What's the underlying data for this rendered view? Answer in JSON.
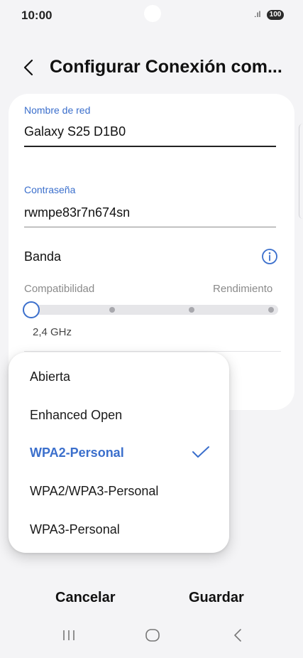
{
  "status_bar": {
    "time": "10:00",
    "battery": "100",
    "signal": ".ıl"
  },
  "header": {
    "title": "Configurar Conexión com..."
  },
  "form": {
    "network_name": {
      "label": "Nombre de red",
      "value": "Galaxy S25 D1B0"
    },
    "password": {
      "label": "Contraseña",
      "value": "rwmpe83r7n674sn"
    },
    "band": {
      "title": "Banda",
      "left_label": "Compatibilidad",
      "right_label": "Rendimiento",
      "selected_value": "2,4 GHz",
      "slider_position": 0,
      "slider_steps": 5
    }
  },
  "security_menu": {
    "options": [
      "Abierta",
      "Enhanced Open",
      "WPA2-Personal",
      "WPA2/WPA3-Personal",
      "WPA3-Personal"
    ],
    "selected": "WPA2-Personal"
  },
  "actions": {
    "cancel": "Cancelar",
    "save": "Guardar"
  },
  "colors": {
    "accent": "#3b6fcc",
    "background": "#f4f4f6",
    "card": "#ffffff"
  },
  "icons": [
    "back-arrow-icon",
    "info-icon",
    "check-icon",
    "recents-icon",
    "home-icon",
    "back-nav-icon"
  ]
}
